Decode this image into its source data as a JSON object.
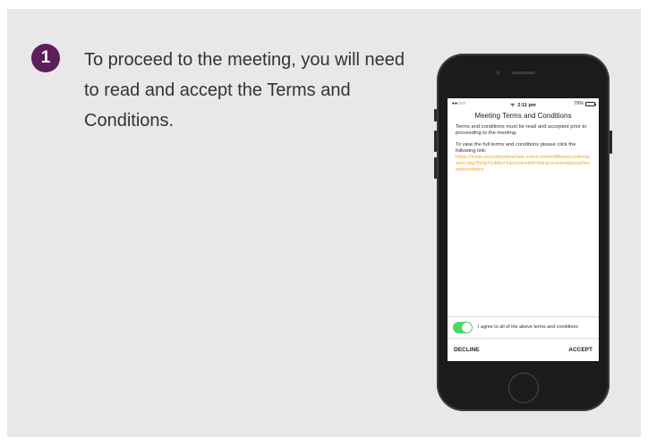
{
  "step": {
    "number": "1",
    "instruction": "To proceed to the meeting, you will need to read and accept the Terms and Conditions."
  },
  "phone": {
    "status_bar": {
      "signal": "●●○○○",
      "wifi": "ᯤ",
      "time": "2:11 pm",
      "battery_percent": "79%"
    },
    "screen_title": "Meeting Terms and Conditions",
    "body": {
      "paragraph1": "Terms and conditions must be read and accepted prior to proceeding to the meeting.",
      "paragraph2": "To view the full terms and conditions please click the following link:",
      "link": "https://www-aucomputershare.com/content/librarycontentpanel.asp?bhjs=1&fta=1&contentId=/librarycontentpanel/investorvotetcs"
    },
    "agree": {
      "label": "I agree to all of the above terms and conditions",
      "toggle_on": true
    },
    "actions": {
      "decline_label": "DECLINE",
      "accept_label": "ACCEPT"
    }
  },
  "colors": {
    "badge": "#5c1f5c",
    "panel": "#e8e8ea",
    "link": "#f0a229",
    "toggle_on": "#4cd964"
  }
}
